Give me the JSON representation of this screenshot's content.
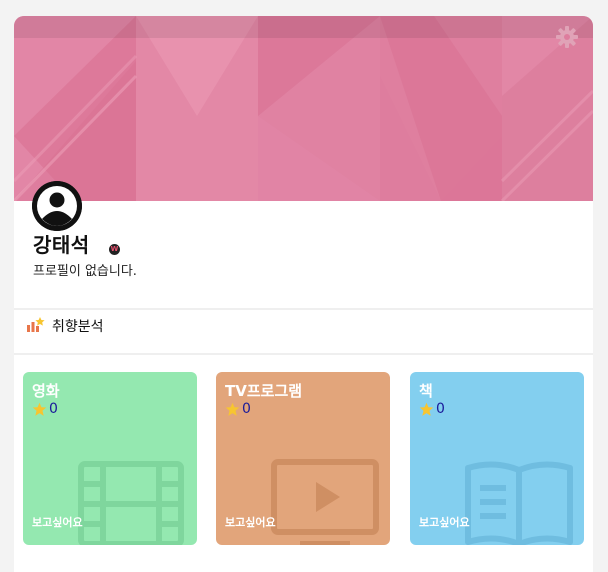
{
  "profile": {
    "name": "강태석",
    "badge_text": "W",
    "bio": "프로필이 없습니다."
  },
  "analysis": {
    "label": "취향분석"
  },
  "categories": [
    {
      "title": "영화",
      "rating": "0",
      "wish": "보고싶어요",
      "icon": "film-icon",
      "color": "#94e8b0",
      "rating_color": "#1a1a9a"
    },
    {
      "title": "TV프로그램",
      "rating": "0",
      "wish": "보고싶어요",
      "icon": "tv-icon",
      "color": "#e2a57b",
      "rating_color": "#1a1a9a"
    },
    {
      "title": "책",
      "rating": "0",
      "wish": "보고싶어요",
      "icon": "book-icon",
      "color": "#83cfef",
      "rating_color": "#1a1a9a"
    }
  ],
  "colors": {
    "cover": "#de7d9e",
    "star": "#f7c530",
    "analysis_icon": "#e8764a"
  }
}
